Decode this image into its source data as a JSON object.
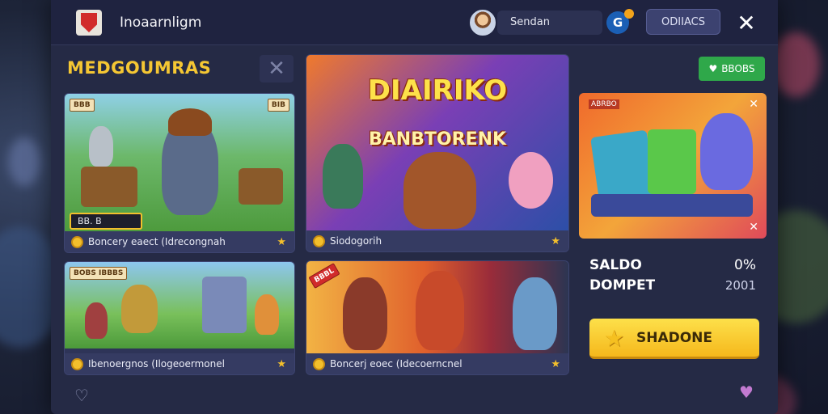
{
  "header": {
    "app_title": "Inoaarnligm",
    "user_name": "Sendan",
    "notif_icon": "G",
    "button_label": "ODIIACS",
    "close_icon": "✕"
  },
  "section": {
    "title": "MEDGOUMRAS",
    "close_icon": "✕"
  },
  "cards": [
    {
      "chip_left": "BBB",
      "chip_right": "BIB",
      "dark_chip": "BB. B",
      "footer": "Boncery eaect (Idrecongnah"
    },
    {
      "hero_line1": "DIAIRIKO",
      "hero_line2": "BANBTORENK",
      "footer": "Siodogorih"
    },
    {
      "chip_left": "BOBS IBBBS",
      "footer": "Ibenoergnos (Ilogeoermonel"
    },
    {
      "ribbon": "BBBL",
      "footer": "Boncerj eoec (Idecoerncnel"
    }
  ],
  "promo": {
    "button_label": "BBOBS",
    "card_label": "ABRBO",
    "close_icon": "✕"
  },
  "balance": {
    "saldo_label": "SALDO",
    "saldo_value": "0%",
    "dompet_label": "DOMPET",
    "dompet_value": "2001"
  },
  "cta": {
    "label": "SHADONE",
    "icon": "★"
  },
  "colors": {
    "accent_yellow": "#f5c733",
    "window_bg": "#252a45",
    "card_bg": "#2e3458",
    "green": "#2fa84a"
  }
}
